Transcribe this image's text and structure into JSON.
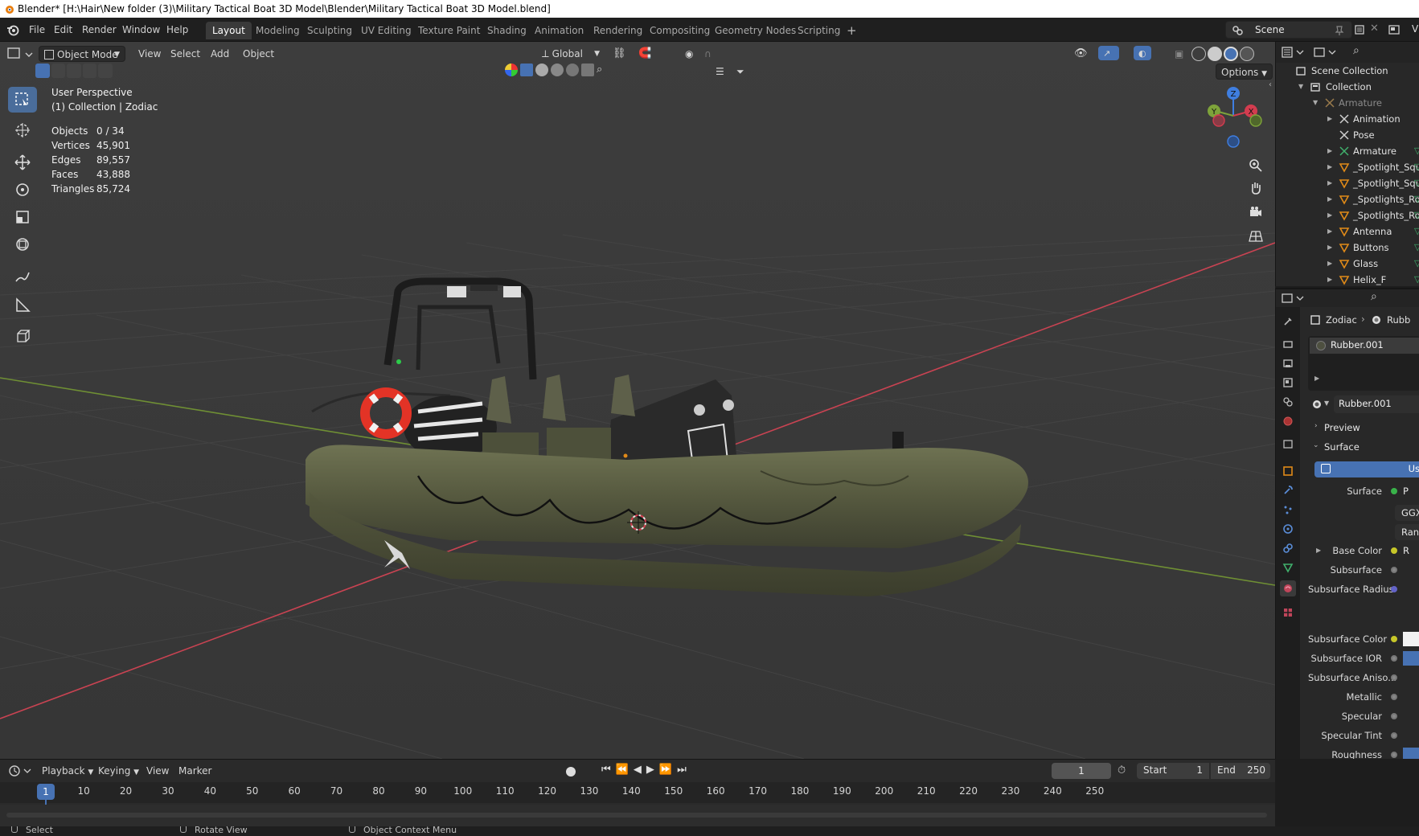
{
  "window": {
    "title": "Blender* [H:\\Hair\\New folder (3)\\Military Tactical Boat 3D Model\\Blender\\Military Tactical Boat 3D Model.blend]"
  },
  "menubar": {
    "items": [
      "File",
      "Edit",
      "Render",
      "Window",
      "Help"
    ],
    "workspaces": [
      "Layout",
      "Modeling",
      "Sculpting",
      "UV Editing",
      "Texture Paint",
      "Shading",
      "Animation",
      "Rendering",
      "Compositing",
      "Geometry Nodes",
      "Scripting"
    ],
    "active_workspace": "Layout",
    "add_workspace": "+",
    "scene_label": "Scene",
    "view_layer_label": "V"
  },
  "viewport": {
    "mode": "Object Mode",
    "menus": [
      "View",
      "Select",
      "Add",
      "Object"
    ],
    "orientation": "Global",
    "options_label": "Options",
    "overlay_title": "User Perspective",
    "overlay_subtitle": "(1) Collection | Zodiac",
    "stats": [
      {
        "label": "Objects",
        "value": "0 / 34"
      },
      {
        "label": "Vertices",
        "value": "45,901"
      },
      {
        "label": "Edges",
        "value": "89,557"
      },
      {
        "label": "Faces",
        "value": "43,888"
      },
      {
        "label": "Triangles",
        "value": "85,724"
      }
    ],
    "gizmo_axes": {
      "x": "X",
      "y": "Y",
      "z": "Z"
    }
  },
  "tools": [
    "select-box-icon",
    "cursor-icon",
    "move-icon",
    "rotate-icon",
    "scale-icon",
    "transform-icon",
    "annotate-icon",
    "measure-icon",
    "add-cube-icon"
  ],
  "outliner": {
    "scene_collection": "Scene Collection",
    "collection": "Collection",
    "items": [
      {
        "name": "Armature",
        "dim": true
      },
      {
        "name": "Animation",
        "dim": false
      },
      {
        "name": "Pose",
        "dim": false
      },
      {
        "name": "Armature",
        "dim": false
      },
      {
        "name": "_Spotlight_Squ",
        "dim": false
      },
      {
        "name": "_Spotlight_Squ",
        "dim": false
      },
      {
        "name": "_Spotlights_Ro",
        "dim": false
      },
      {
        "name": "_Spotlights_Ro",
        "dim": false
      },
      {
        "name": "Antenna",
        "dim": false
      },
      {
        "name": "Buttons",
        "dim": false
      },
      {
        "name": "Glass",
        "dim": false
      },
      {
        "name": "Helix_F",
        "dim": false
      }
    ]
  },
  "properties": {
    "breadcrumb_object": "Zodiac",
    "breadcrumb_material": "Rubb",
    "slot_name": "Rubber.001",
    "material_name": "Rubber.001",
    "preview_label": "Preview",
    "surface_section": "Surface",
    "use_nodes_label": "Us",
    "surface_label": "Surface",
    "surface_value": "P",
    "distribution_value": "GGX",
    "subsurface_method_value": "Ran",
    "base_color_value": "R",
    "fields": [
      "Base Color",
      "Subsurface",
      "Subsurface Radius",
      "Subsurface Color",
      "Subsurface IOR",
      "Subsurface Aniso...",
      "Metallic",
      "Specular",
      "Specular Tint",
      "Roughness"
    ]
  },
  "timeline": {
    "menus": [
      "Playback",
      "Keying",
      "View",
      "Marker"
    ],
    "current_frame": "1",
    "start_label": "Start",
    "start_value": "1",
    "end_label": "End",
    "end_value": "250",
    "ticks": [
      "10",
      "20",
      "30",
      "40",
      "50",
      "60",
      "70",
      "80",
      "90",
      "100",
      "110",
      "120",
      "130",
      "140",
      "150",
      "160",
      "170",
      "180",
      "190",
      "200",
      "210",
      "220",
      "230",
      "240",
      "250"
    ]
  },
  "statusbar": {
    "select": "Select",
    "rotate": "Rotate View",
    "context": "Object Context Menu"
  },
  "colors": {
    "accent": "#4772b3",
    "boat_body": "#56593f",
    "viewport_bg": "#393939",
    "x_axis": "#d33c4f",
    "y_axis": "#7ea33a",
    "z_axis": "#3f7ee0"
  }
}
